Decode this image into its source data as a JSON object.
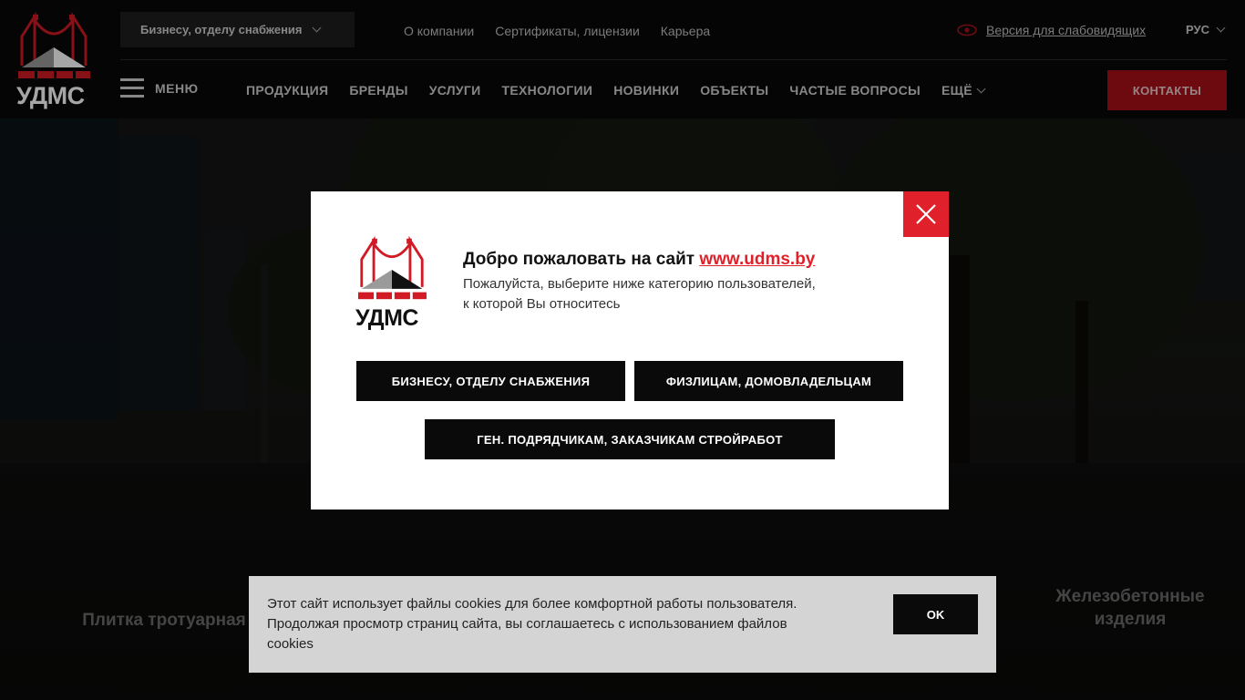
{
  "header": {
    "logo_text": "УДМС",
    "segment_select": "Бизнесу, отделу снабжения",
    "top_links": [
      "О компании",
      "Сертификаты, лицензии",
      "Карьера"
    ],
    "vision_link": "Версия для слабовидящих",
    "language": "РУС",
    "menu_label": "МЕНЮ",
    "nav_items": [
      "ПРОДУКЦИЯ",
      "БРЕНДЫ",
      "УСЛУГИ",
      "ТЕХНОЛОГИИ",
      "НОВИНКИ",
      "ОБЪЕКТЫ",
      "ЧАСТЫЕ ВОПРОСЫ",
      "ЕЩЁ"
    ],
    "contacts_label": "КОНТАКТЫ",
    "accent_color": "#a8101a"
  },
  "background": {
    "categories": [
      "Плитка тротуарная",
      "Железобетонные изделия"
    ]
  },
  "modal": {
    "logo_text": "УДМС",
    "title_prefix": "Добро пожаловать на сайт",
    "title_link": "www.udms.by",
    "subtitle_line1": "Пожалуйста, выберите ниже категорию пользователей,",
    "subtitle_line2": "к которой Вы относитесь",
    "buttons": [
      "БИЗНЕСУ, ОТДЕЛУ СНАБЖЕНИЯ",
      "ФИЗЛИЦАМ, ДОМОВЛАДЕЛЬЦАМ",
      "ГЕН. ПОДРЯДЧИКАМ, ЗАКАЗЧИКАМ СТРОЙРАБОТ"
    ],
    "close_color": "#e0212b"
  },
  "cookie": {
    "line1": "Этот сайт использует файлы cookies для более комфортной работы пользователя.",
    "line2": "Продолжая просмотр страниц сайта, вы соглашаетесь с использованием файлов",
    "line3": "cookies",
    "ok_label": "OK"
  }
}
